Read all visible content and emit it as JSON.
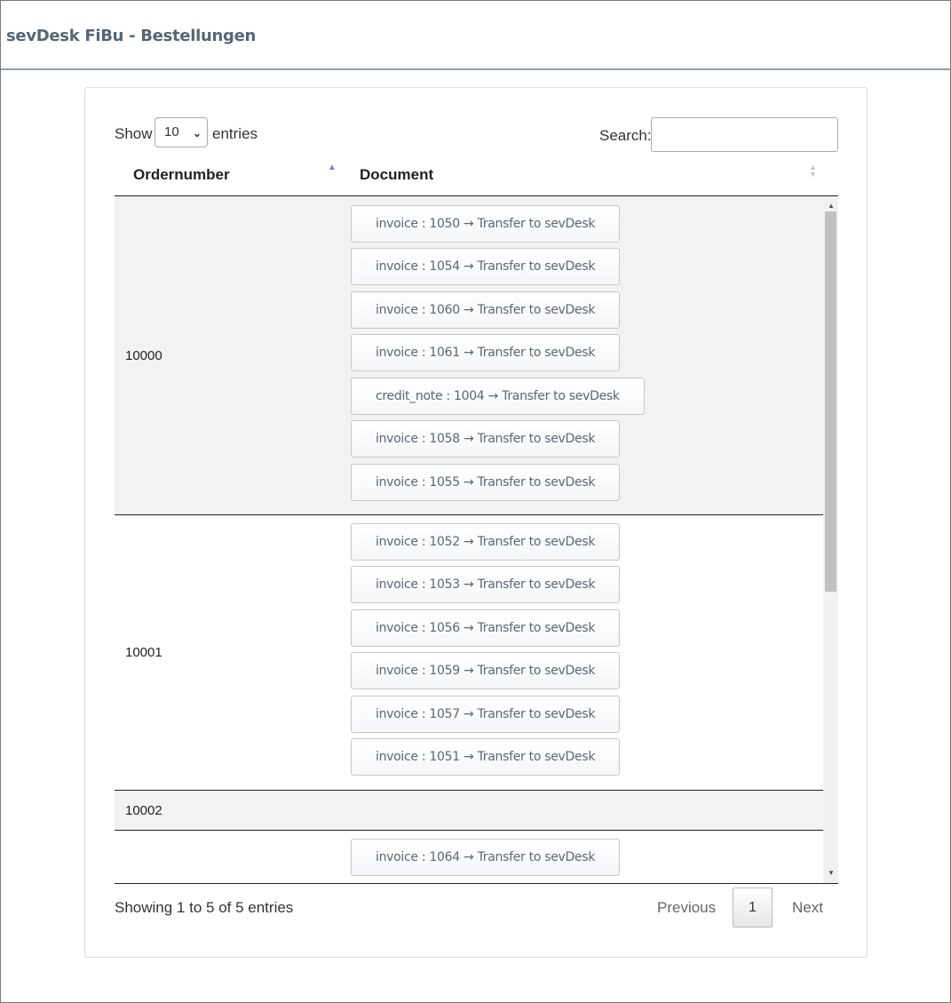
{
  "header": {
    "title": "sevDesk FiBu - Bestellungen"
  },
  "controls": {
    "show_label": "Show",
    "length_value": "10",
    "entries_label": "entries",
    "search_label": "Search:",
    "search_value": ""
  },
  "table": {
    "columns": [
      "Ordernumber",
      "Document"
    ],
    "rows": [
      {
        "order": "10000",
        "documents": [
          "invoice : 1050 → Transfer to sevDesk",
          "invoice : 1054 → Transfer to sevDesk",
          "invoice : 1060 → Transfer to sevDesk",
          "invoice : 1061 → Transfer to sevDesk",
          "credit_note : 1004 → Transfer to sevDesk",
          "invoice : 1058 → Transfer to sevDesk",
          "invoice : 1055 → Transfer to sevDesk"
        ]
      },
      {
        "order": "10001",
        "documents": [
          "invoice : 1052 → Transfer to sevDesk",
          "invoice : 1053 → Transfer to sevDesk",
          "invoice : 1056 → Transfer to sevDesk",
          "invoice : 1059 → Transfer to sevDesk",
          "invoice : 1057 → Transfer to sevDesk",
          "invoice : 1051 → Transfer to sevDesk"
        ]
      },
      {
        "order": "10002",
        "documents": []
      },
      {
        "order": "",
        "documents": [
          "invoice : 1064 → Transfer to sevDesk"
        ]
      }
    ]
  },
  "footer": {
    "info": "Showing 1 to 5 of 5 entries",
    "previous": "Previous",
    "current_page": "1",
    "next": "Next"
  }
}
